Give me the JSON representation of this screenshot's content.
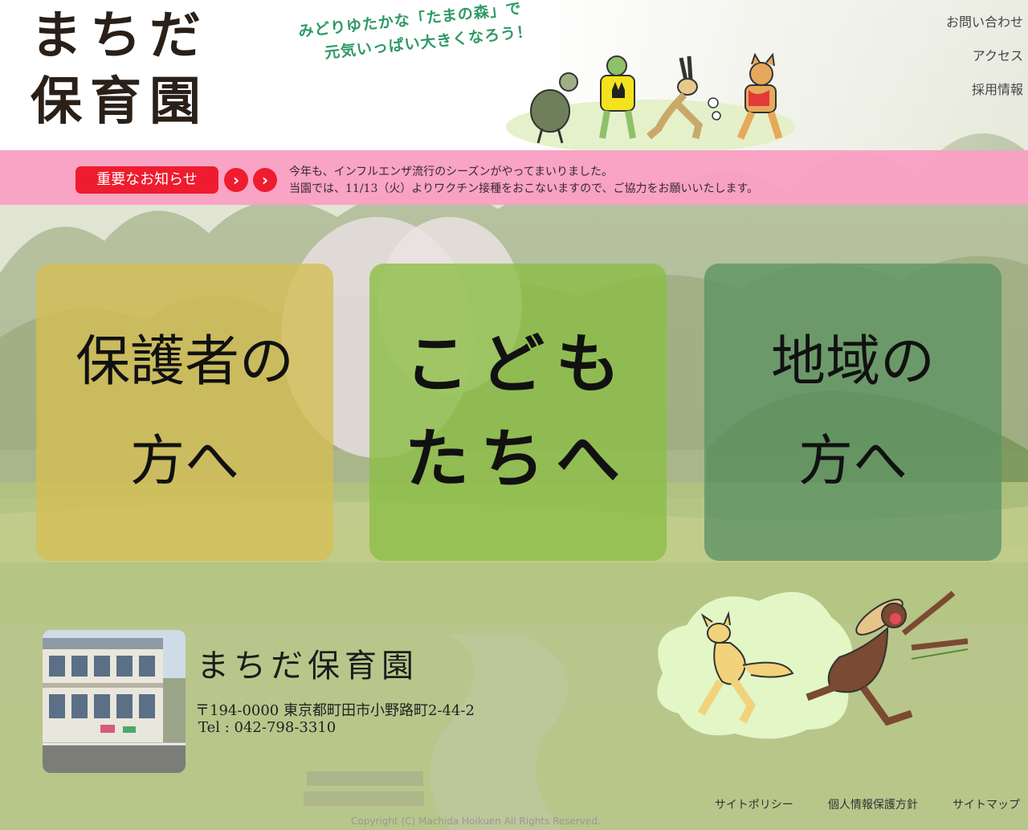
{
  "header": {
    "logo_line1": "まちだ",
    "logo_line2": "保育園",
    "tagline_line1": "みどりゆたかな「たまの森」で",
    "tagline_line2": "元気いっぱい大きくなろう！",
    "nav": {
      "contact": "お問い合わせ",
      "access": "アクセス",
      "recruit": "採用情報"
    }
  },
  "notice": {
    "badge": "重要なお知らせ",
    "arrow": "›",
    "line1": "今年も、インフルエンザ流行のシーズンがやってまいりました。",
    "line2": "当園では、11/13（火）よりワクチン接種をおこないますので、ご協力をお願いいたします。"
  },
  "panels": {
    "parents": {
      "line1": "保護者の",
      "line2": "方へ"
    },
    "kids": {
      "line1": "こども",
      "line2": "たちへ"
    },
    "community": {
      "line1": "地域の",
      "line2": "方へ"
    }
  },
  "footer": {
    "name": "まちだ保育園",
    "address": "〒194-0000 東京都町田市小野路町2-44-2",
    "tel": "Tel : 042-798-3310",
    "links": {
      "policy": "サイトポリシー",
      "privacy": "個人情報保護方針",
      "sitemap": "サイトマップ"
    },
    "copyright": "Copyright (C) Machida Hoikuen All Rights Reserved."
  },
  "colors": {
    "notice_bar": "#faa0c4",
    "badge_red": "#ee1c2e",
    "tagline_green": "#2e9a66",
    "panel_parents": "#d4be55",
    "panel_kids": "#8cbe46",
    "panel_community": "#5f9464"
  },
  "icons": {
    "notice_arrows": "chevron-right-circle-icon"
  }
}
